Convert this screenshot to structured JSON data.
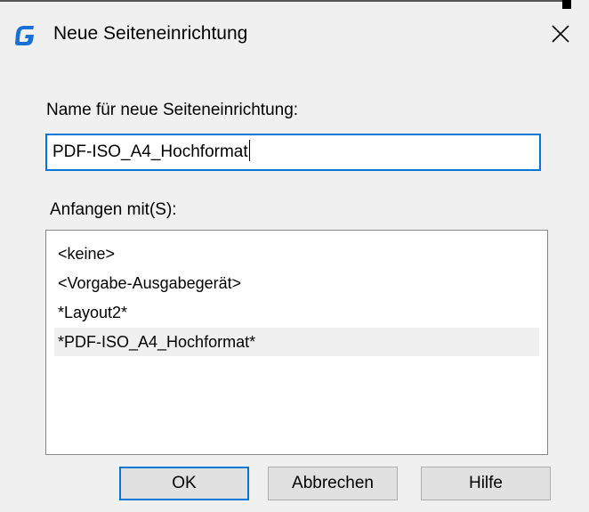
{
  "window": {
    "title": "Neue Seiteneinrichtung",
    "icon": "app-g-logo-icon",
    "accent_color": "#0078d7"
  },
  "form": {
    "name_label": "Name für neue Seiteneinrichtung:",
    "name_value": "PDF-ISO_A4_Hochformat",
    "start_label": "Anfangen mit(S):"
  },
  "list": {
    "items": [
      {
        "label": "<keine>",
        "selected": false
      },
      {
        "label": "<Vorgabe-Ausgabegerät>",
        "selected": false
      },
      {
        "label": "*Layout2*",
        "selected": false
      },
      {
        "label": "*PDF-ISO_A4_Hochformat*",
        "selected": true
      }
    ]
  },
  "buttons": {
    "ok_label": "OK",
    "cancel_label": "Abbrechen",
    "help_label": "Hilfe"
  }
}
